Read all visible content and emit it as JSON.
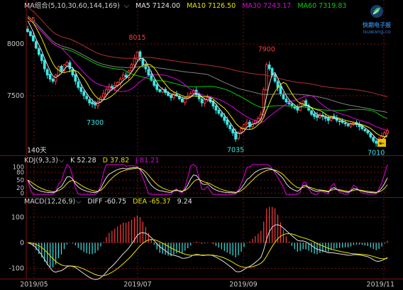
{
  "legends": {
    "main": {
      "title": "MA组合(5,10,30,60,144,169)",
      "ma5": "MA5 7124.00",
      "ma10": "MA10 7126.50",
      "ma30": "MA30 7243.17",
      "ma60": "MA60 7319.83"
    },
    "kdj": {
      "title": "KDJ(9,3,3)",
      "k": "K 52.28",
      "d": "D 37.82",
      "j": "J 81.21"
    },
    "macd": {
      "title": "MACD(12,26,9)",
      "diff": "DIFF -60.75",
      "dea": "DEA -65.37",
      "macd": "9.24"
    }
  },
  "watermark": {
    "line1": "快期电子报",
    "line2": "isuwang.co"
  },
  "colors": {
    "bg": "#000000",
    "grid": "#7a1010",
    "up": "#ff3b3b",
    "down": "#3ee6e6",
    "ma5": "#e0e0e0",
    "ma10": "#e6e600",
    "ma30": "#e000e0",
    "ma60": "#00d000",
    "ma144": "#808080",
    "ma169": "#b03030",
    "k": "#e0e0e0",
    "d": "#e6e600",
    "j": "#e000e0"
  },
  "chart_data": [
    {
      "type": "candlestick",
      "title": "",
      "x_tick_labels": [
        "2019/05",
        "2019/07",
        "2019/09",
        "2019/11"
      ],
      "y_ticks": [
        7500,
        8000
      ],
      "ylim": [
        6930,
        8330
      ],
      "annotations": [
        {
          "text": "35",
          "value": 8185,
          "index": 0
        },
        {
          "text": "8015",
          "value": 8015,
          "index": 39
        },
        {
          "text": "7300",
          "value": 7300,
          "index": 24
        },
        {
          "text": "7900",
          "value": 7900,
          "index": 85
        },
        {
          "text": "7035",
          "value": 7035,
          "index": 74
        },
        {
          "text": "7010",
          "value": 7010,
          "index": 124
        }
      ],
      "period_label": "140天",
      "series_names": [
        "MA5",
        "MA10",
        "MA30",
        "MA60"
      ],
      "closes": [
        8120,
        8080,
        8030,
        7960,
        7900,
        7840,
        7760,
        7700,
        7660,
        7640,
        7700,
        7780,
        7740,
        7800,
        7820,
        7760,
        7700,
        7640,
        7580,
        7540,
        7500,
        7470,
        7430,
        7420,
        7410,
        7440,
        7480,
        7520,
        7560,
        7590,
        7570,
        7600,
        7630,
        7660,
        7700,
        7680,
        7740,
        7800,
        7860,
        7920,
        7860,
        7800,
        7760,
        7700,
        7650,
        7600,
        7560,
        7540,
        7560,
        7530,
        7500,
        7480,
        7520,
        7500,
        7470,
        7440,
        7480,
        7500,
        7520,
        7550,
        7510,
        7470,
        7430,
        7460,
        7480,
        7440,
        7400,
        7360,
        7330,
        7300,
        7260,
        7220,
        7180,
        7140,
        7080,
        7140,
        7180,
        7220,
        7240,
        7200,
        7230,
        7260,
        7280,
        7320,
        7560,
        7800,
        7760,
        7700,
        7640,
        7580,
        7520,
        7470,
        7440,
        7420,
        7400,
        7380,
        7360,
        7420,
        7450,
        7400,
        7360,
        7320,
        7300,
        7290,
        7320,
        7300,
        7280,
        7260,
        7300,
        7280,
        7260,
        7250,
        7240,
        7230,
        7210,
        7230,
        7240,
        7220,
        7200,
        7180,
        7160,
        7140,
        7100,
        7060,
        7040,
        7080,
        7110,
        7140,
        7160
      ]
    },
    {
      "type": "line",
      "title": "KDJ(9,3,3)",
      "y_ticks": [
        0,
        20,
        50,
        80,
        100
      ],
      "ylim": [
        -10,
        110
      ],
      "series": [
        {
          "name": "K",
          "values": [
            52.28
          ]
        },
        {
          "name": "D",
          "values": [
            37.82
          ]
        },
        {
          "name": "J",
          "values": [
            81.21
          ]
        }
      ]
    },
    {
      "type": "bar",
      "title": "MACD(12,26,9)",
      "y_ticks": [
        -100,
        0,
        100
      ],
      "ylim": [
        -140,
        145
      ],
      "series": [
        {
          "name": "DIFF",
          "values": [
            -60.75
          ]
        },
        {
          "name": "DEA",
          "values": [
            -65.37
          ]
        },
        {
          "name": "MACD",
          "values": [
            9.24
          ]
        }
      ]
    }
  ]
}
